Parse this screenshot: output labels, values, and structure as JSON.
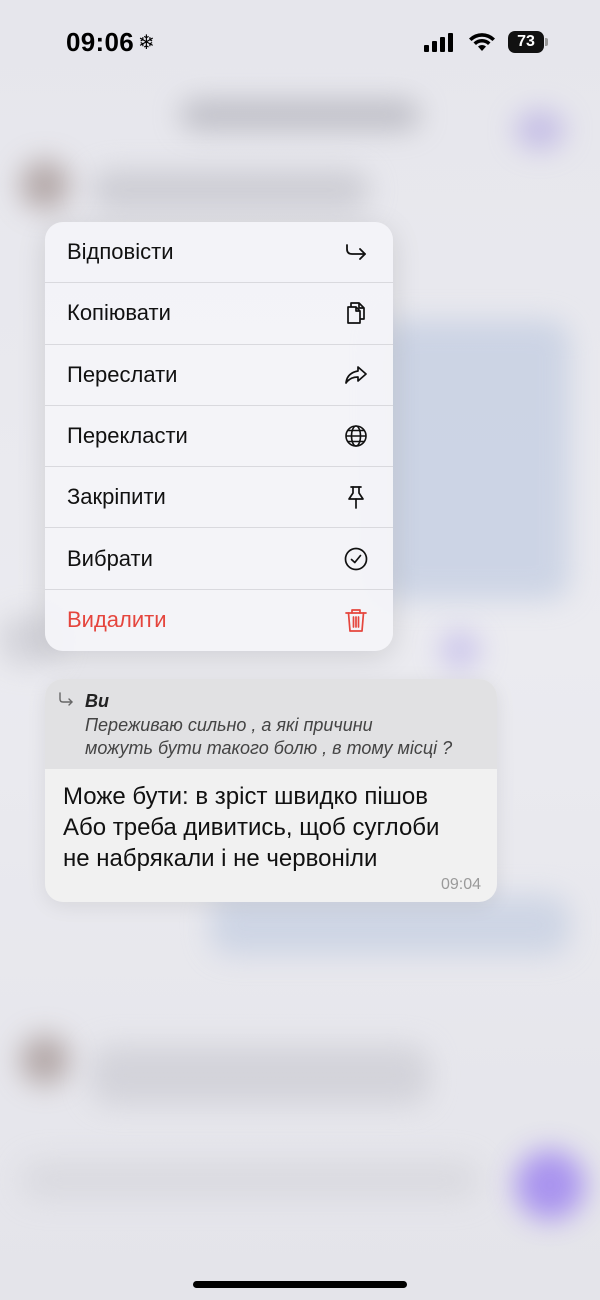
{
  "statusbar": {
    "time": "09:06",
    "time_icon": "snowflake-icon",
    "battery": "73"
  },
  "menu": {
    "items": [
      {
        "label": "Відповісти",
        "icon": "reply-icon"
      },
      {
        "label": "Копіювати",
        "icon": "copy-icon"
      },
      {
        "label": "Переслати",
        "icon": "forward-icon"
      },
      {
        "label": "Перекласти",
        "icon": "globe-icon"
      },
      {
        "label": "Закріпити",
        "icon": "pin-icon"
      },
      {
        "label": "Вибрати",
        "icon": "checkmark-circle-icon"
      },
      {
        "label": "Видалити",
        "icon": "trash-icon"
      }
    ],
    "danger_color": "#e5453d"
  },
  "message": {
    "quote": {
      "author": "Ви",
      "line1": "Переживаю сильно , а які причини",
      "line2": "можуть бути такого болю , в тому місці ?"
    },
    "line1": "Може бути: в зріст швидко пішов",
    "line2": "Або треба дивитись, щоб суглоби",
    "line3": "не набрякали і не червоніли",
    "time": "09:04"
  }
}
